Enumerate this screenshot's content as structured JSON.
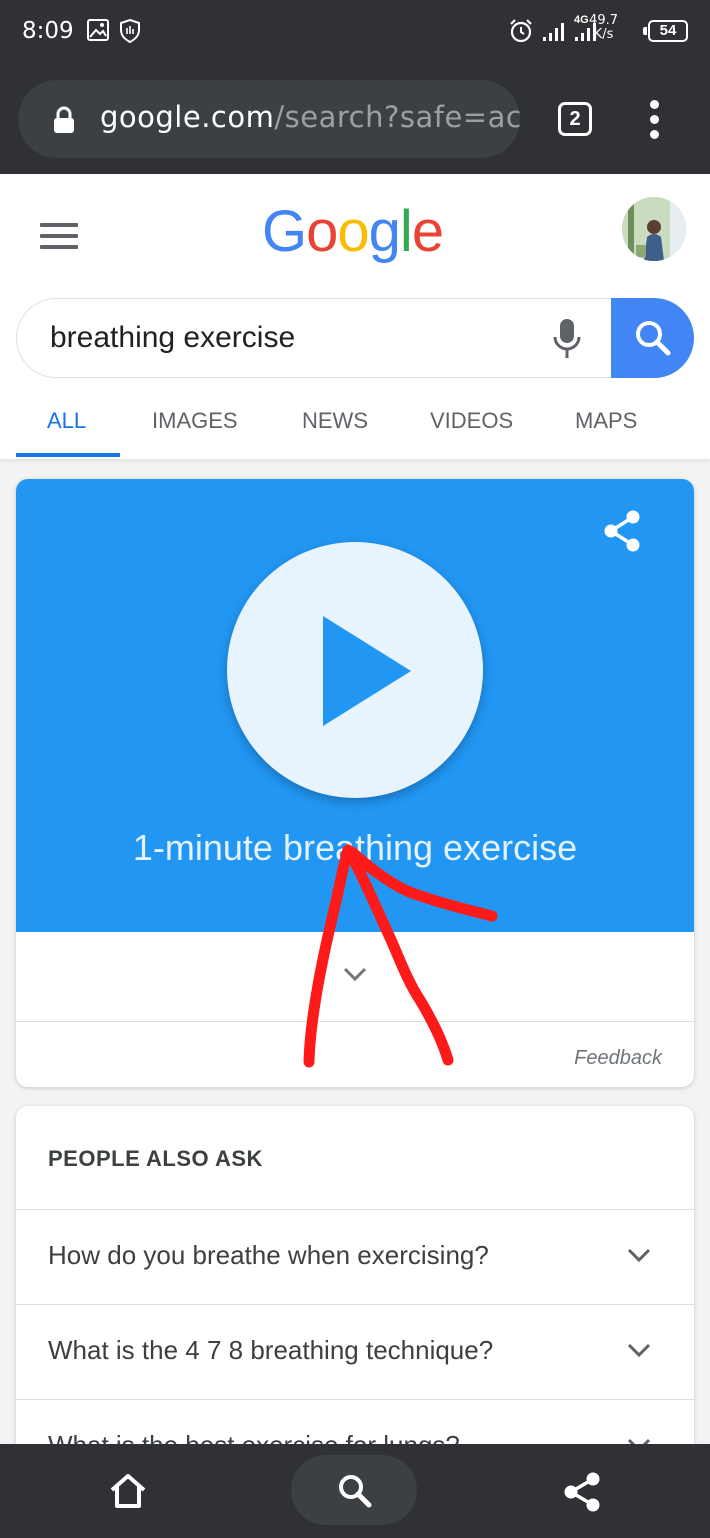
{
  "status_bar": {
    "time": "8:09",
    "network_type": "4G",
    "speed_value": "49.7",
    "speed_unit": "K/s",
    "battery": "54"
  },
  "browser": {
    "url_host": "google.com",
    "url_path": "/search?safe=ac",
    "tab_count": "2"
  },
  "google": {
    "logo_letters": [
      "G",
      "o",
      "o",
      "g",
      "l",
      "e"
    ],
    "logo_colors": [
      "#4285f4",
      "#ea4335",
      "#fbbc05",
      "#4285f4",
      "#34a853",
      "#ea4335"
    ],
    "query": "breathing exercise",
    "tabs": [
      "ALL",
      "IMAGES",
      "NEWS",
      "VIDEOS",
      "MAPS"
    ],
    "active_tab": "ALL",
    "accent_color": "#1a73e8"
  },
  "exercise_card": {
    "title": "1-minute breathing exercise",
    "feedback": "Feedback",
    "background_color": "#2196f3"
  },
  "people_also_ask": {
    "heading": "PEOPLE ALSO ASK",
    "questions": [
      "How do you breathe when exercising?",
      "What is the 4 7 8 breathing technique?",
      "What is the best exercise for lungs?"
    ]
  },
  "annotation": {
    "color": "#ff1a1a",
    "shape": "hand-drawn arrow"
  },
  "bottom_nav": {
    "icons": [
      "home-icon",
      "search-icon",
      "share-icon"
    ]
  }
}
